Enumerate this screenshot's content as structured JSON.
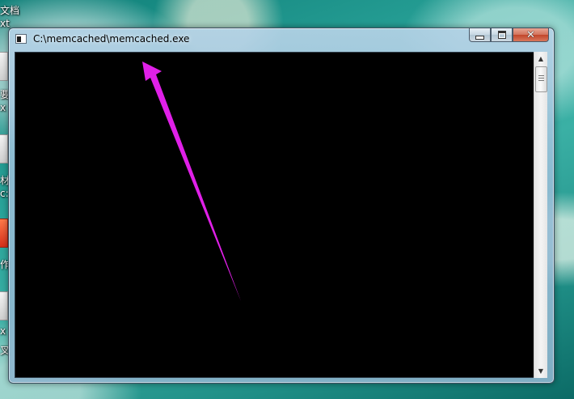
{
  "desktop": {
    "labels": [
      "文档",
      "xt",
      "要",
      "x",
      "材",
      "c:",
      "作",
      "x",
      "叉"
    ]
  },
  "window": {
    "title": "C:\\memcached\\memcached.exe",
    "close_symbol": "✕"
  },
  "scrollbar": {
    "up_arrow": "▲",
    "down_arrow": "▼"
  },
  "annotation": {
    "arrow_color": "#e020e8"
  }
}
